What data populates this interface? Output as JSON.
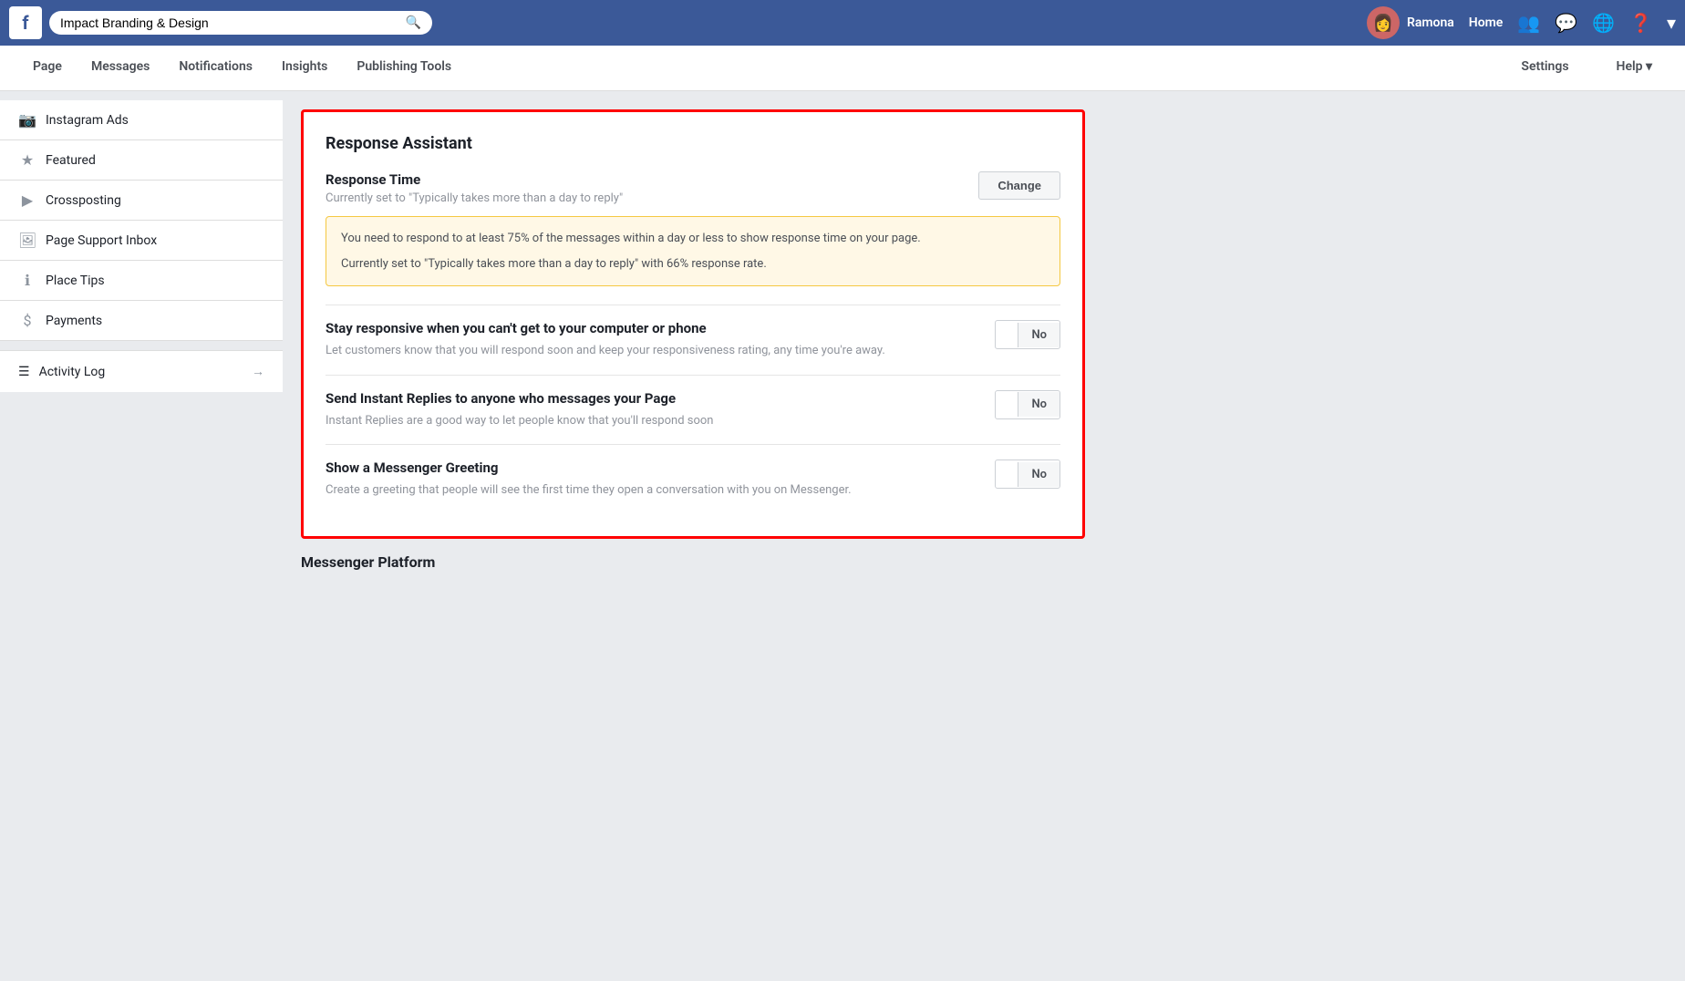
{
  "topbar": {
    "logo": "f",
    "search_placeholder": "Impact Branding & Design",
    "user_name": "Ramona",
    "home_label": "Home"
  },
  "page_nav": {
    "items": [
      {
        "id": "page",
        "label": "Page"
      },
      {
        "id": "messages",
        "label": "Messages"
      },
      {
        "id": "notifications",
        "label": "Notifications"
      },
      {
        "id": "insights",
        "label": "Insights"
      },
      {
        "id": "publishing-tools",
        "label": "Publishing Tools"
      }
    ],
    "right_items": [
      {
        "id": "settings",
        "label": "Settings"
      },
      {
        "id": "help",
        "label": "Help ▾"
      }
    ]
  },
  "sidebar": {
    "items": [
      {
        "id": "instagram-ads",
        "label": "Instagram Ads",
        "icon": "📷"
      },
      {
        "id": "featured",
        "label": "Featured",
        "icon": "★"
      },
      {
        "id": "crossposting",
        "label": "Crossposting",
        "icon": "🎬"
      },
      {
        "id": "page-support-inbox",
        "label": "Page Support Inbox",
        "icon": "🖼"
      },
      {
        "id": "place-tips",
        "label": "Place Tips",
        "icon": "ℹ"
      },
      {
        "id": "payments",
        "label": "Payments",
        "icon": "$"
      }
    ],
    "activity_log": {
      "label": "Activity Log",
      "icon": "☰"
    }
  },
  "response_assistant": {
    "title": "Response Assistant",
    "response_time": {
      "section_title": "Response Time",
      "subtitle": "Currently set to \"Typically takes more than a day to reply\"",
      "change_label": "Change",
      "warning": {
        "line1": "You need to respond to at least 75% of the messages within a day or less to show response time on your page.",
        "line2": "Currently set to \"Typically takes more than a day to reply\" with 66% response rate."
      }
    },
    "stay_responsive": {
      "title": "Stay responsive when you can't get to your computer or phone",
      "description": "Let customers know that you will respond soon and keep your responsiveness rating, any time you're away.",
      "toggle_label": "No"
    },
    "instant_replies": {
      "title": "Send Instant Replies to anyone who messages your Page",
      "description": "Instant Replies are a good way to let people know that you'll respond soon",
      "toggle_label": "No"
    },
    "messenger_greeting": {
      "title": "Show a Messenger Greeting",
      "description": "Create a greeting that people will see the first time they open a conversation with you on Messenger.",
      "toggle_label": "No"
    }
  },
  "messenger_platform": {
    "title": "Messenger Platform"
  }
}
